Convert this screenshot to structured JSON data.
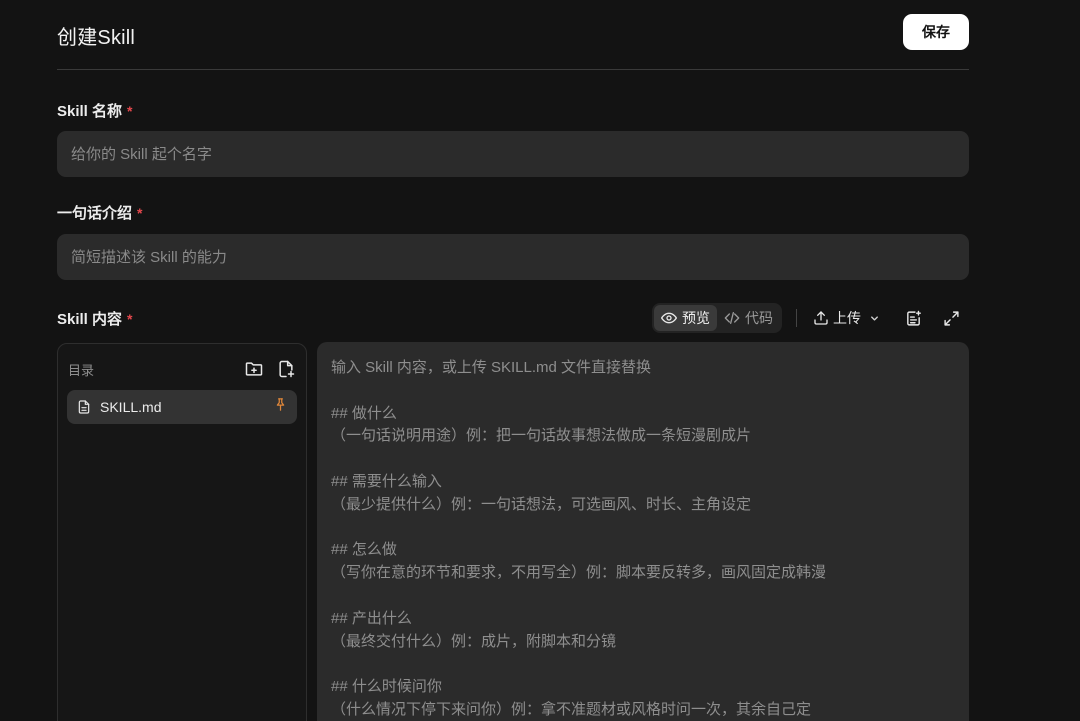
{
  "header": {
    "title": "创建Skill",
    "save_label": "保存"
  },
  "form": {
    "name": {
      "label": "Skill 名称",
      "required_mark": "*",
      "placeholder": "给你的 Skill 起个名字"
    },
    "intro": {
      "label": "一句话介绍",
      "required_mark": "*",
      "placeholder": "简短描述该 Skill 的能力"
    },
    "content": {
      "label": "Skill 内容",
      "required_mark": "*"
    }
  },
  "toolbar": {
    "preview_label": "预览",
    "code_label": "代码",
    "upload_label": "上传",
    "active_view": "preview"
  },
  "sidebar": {
    "title": "目录",
    "files": [
      {
        "name": "SKILL.md",
        "icon": "file-icon",
        "pinned": true
      }
    ]
  },
  "editor": {
    "lines": [
      "输入 Skill 内容，或上传 SKILL.md 文件直接替换",
      "",
      "## 做什么",
      "（一句话说明用途）例：把一句话故事想法做成一条短漫剧成片",
      "",
      "## 需要什么输入",
      "（最少提供什么）例：一句话想法，可选画风、时长、主角设定",
      "",
      "## 怎么做",
      "（写你在意的环节和要求，不用写全）例：脚本要反转多，画风固定成韩漫",
      "",
      "## 产出什么",
      "（最终交付什么）例：成片，附脚本和分镜",
      "",
      "## 什么时候问你",
      "（什么情况下停下来问你）例：拿不准题材或风格时问一次，其余自己定"
    ]
  },
  "colors": {
    "background": "#131313",
    "field": "#2b2b2b",
    "required": "#e5484d",
    "pin": "#e0873a"
  }
}
